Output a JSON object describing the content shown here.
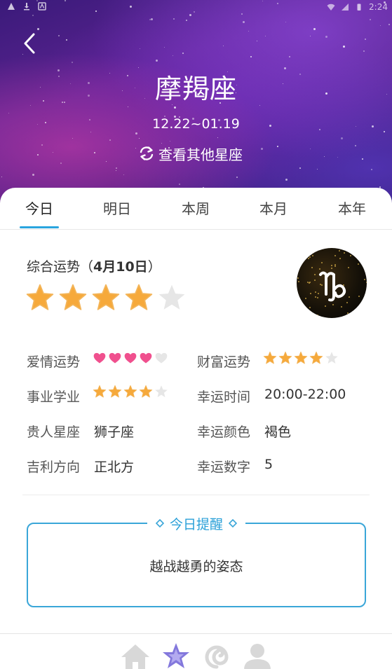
{
  "status_bar": {
    "time": "2:24"
  },
  "header": {
    "title": "摩羯座",
    "date_range": "12.22~01.19",
    "switch_label": "查看其他星座"
  },
  "tabs": [
    {
      "label": "今日",
      "active": true
    },
    {
      "label": "明日",
      "active": false
    },
    {
      "label": "本周",
      "active": false
    },
    {
      "label": "本月",
      "active": false
    },
    {
      "label": "本年",
      "active": false
    }
  ],
  "overall": {
    "label_prefix": "综合运势（",
    "date": "4月10日",
    "label_suffix": "）",
    "rating": 4,
    "max": 5
  },
  "fortune": {
    "love": {
      "label": "爱情运势",
      "rating": 4,
      "max": 5
    },
    "wealth": {
      "label": "财富运势",
      "rating": 4,
      "max": 5
    },
    "career": {
      "label": "事业学业",
      "rating": 4,
      "max": 5
    },
    "lucky_time": {
      "label": "幸运时间",
      "value": "20:00-22:00"
    },
    "noble_sign": {
      "label": "贵人星座",
      "value": "狮子座"
    },
    "lucky_color": {
      "label": "幸运颜色",
      "value": "褐色"
    },
    "direction": {
      "label": "吉利方向",
      "value": "正北方"
    },
    "lucky_number": {
      "label": "幸运数字",
      "value": "5"
    }
  },
  "reminder": {
    "title": "今日提醒",
    "text": "越战越勇的姿态"
  },
  "colors": {
    "accent": "#2aa5df",
    "star_filled": "#f6a93b",
    "star_empty": "#e6e6e6",
    "heart_filled": "#f0508e",
    "nav_active": "#7b6fd6"
  },
  "icons": {
    "back": "back-arrow-icon",
    "switch": "refresh-icon",
    "nav": [
      "home-icon",
      "star-icon",
      "swirl-icon",
      "user-icon"
    ]
  }
}
